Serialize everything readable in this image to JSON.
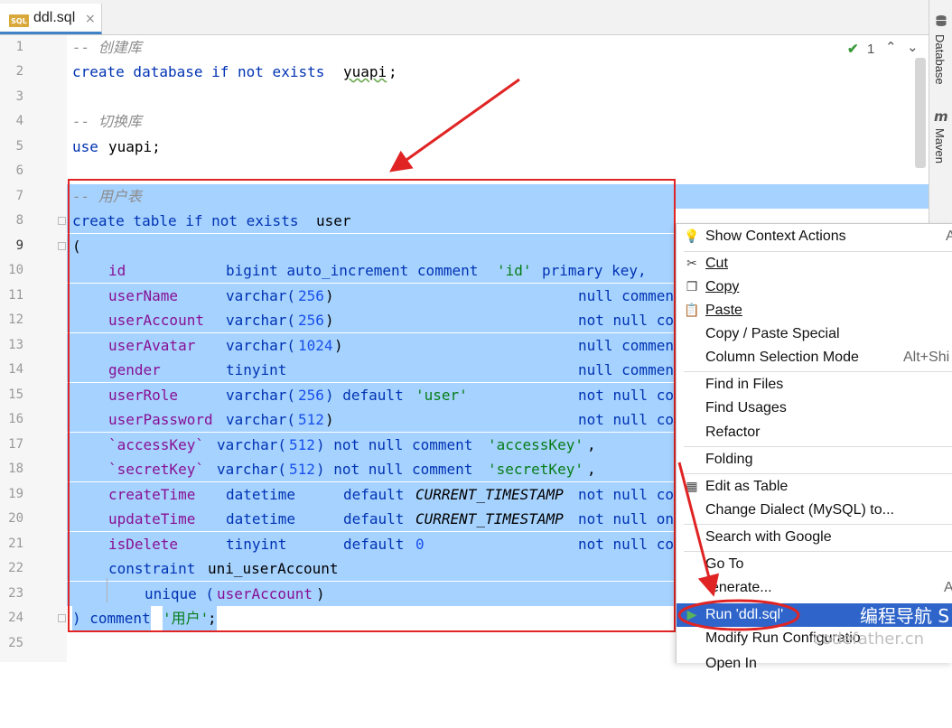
{
  "tab": {
    "icon_text": "SQL",
    "filename": "ddl.sql",
    "close": "×"
  },
  "toolwindows": {
    "database": "Database",
    "maven": "Maven",
    "maven_icon": "m"
  },
  "inspection": {
    "check_icon": "check-icon",
    "count": "1",
    "up": "⌃",
    "down": "⌄"
  },
  "editor": {
    "line_numbers": [
      "1",
      "2",
      "3",
      "4",
      "5",
      "6",
      "7",
      "8",
      "9",
      "10",
      "11",
      "12",
      "13",
      "14",
      "15",
      "16",
      "17",
      "18",
      "19",
      "20",
      "21",
      "22",
      "23",
      "24",
      "25"
    ],
    "current_line": "9",
    "l1": "-- 创建库",
    "l2": {
      "a": "create database if not exists",
      "b": "yuapi",
      "c": ";"
    },
    "l4": "-- 切换库",
    "l5": {
      "a": "use",
      "b": "yuapi;"
    },
    "l7": "-- 用户表",
    "l8": {
      "a": "create table if not exists",
      "b": "user"
    },
    "l9": "(",
    "l10": {
      "c": "id",
      "t": "bigint auto_increment comment",
      "s": "'id'",
      "r": "primary key,"
    },
    "l11": {
      "c": "userName",
      "t": "varchar(",
      "n": "256",
      "p": ")",
      "r": "null commen"
    },
    "l12": {
      "c": "userAccount",
      "t": "varchar(",
      "n": "256",
      "p": ")",
      "r": "not null co"
    },
    "l13": {
      "c": "userAvatar",
      "t": "varchar(",
      "n": "1024",
      "p": ")",
      "r": "null commen"
    },
    "l14": {
      "c": "gender",
      "t": "tinyint",
      "r": "null commen"
    },
    "l15": {
      "c": "userRole",
      "t": "varchar(",
      "n": "256",
      "p": ") default",
      "s": "'user'",
      "r": "not null co"
    },
    "l16": {
      "c": "userPassword",
      "t": "varchar(",
      "n": "512",
      "p": ")",
      "r": "not null co"
    },
    "l17": {
      "c": "`accessKey`",
      "t": "varchar(",
      "n": "512",
      "p": ") not null comment",
      "s": "'accessKey'",
      "e": ","
    },
    "l18": {
      "c": "`secretKey`",
      "t": "varchar(",
      "n": "512",
      "p": ") not null comment",
      "s": "'secretKey'",
      "e": ","
    },
    "l19": {
      "c": "createTime",
      "t": "datetime",
      "d": "default",
      "i": "CURRENT_TIMESTAMP",
      "r": "not null co"
    },
    "l20": {
      "c": "updateTime",
      "t": "datetime",
      "d": "default",
      "i": "CURRENT_TIMESTAMP",
      "r": "not null on"
    },
    "l21": {
      "c": "isDelete",
      "t": "tinyint",
      "d": "default",
      "n": "0",
      "r": "not null co"
    },
    "l22": {
      "a": "constraint",
      "b": "uni_userAccount"
    },
    "l23": {
      "a": "unique (",
      "c": "userAccount",
      "p": ")"
    },
    "l24": {
      "a": ") comment",
      "s": "'用户'",
      "e": ";"
    }
  },
  "menu": {
    "items": [
      {
        "label": "Show Context Actions",
        "shortcut": "A",
        "icon": "lightbulb-icon"
      },
      {
        "label": "Cut",
        "icon": "scissors-icon"
      },
      {
        "label": "Copy",
        "icon": "copy-icon"
      },
      {
        "label": "Paste",
        "icon": "clipboard-icon"
      },
      {
        "label": "Copy / Paste Special"
      },
      {
        "label": "Column Selection Mode",
        "shortcut": "Alt+Shi"
      },
      {
        "label": "Find in Files"
      },
      {
        "label": "Find Usages"
      },
      {
        "label": "Refactor"
      },
      {
        "label": "Folding"
      },
      {
        "label": "Edit as Table",
        "icon": "table-icon"
      },
      {
        "label": "Change Dialect (MySQL) to..."
      },
      {
        "label": "Search with Google"
      },
      {
        "label": "Go To"
      },
      {
        "label": "enerate...",
        "shortcut": "A"
      },
      {
        "label": "Run 'ddl.sql'",
        "icon": "run-icon"
      },
      {
        "label": "Modify Run Configuratio"
      },
      {
        "label": "Open In"
      }
    ]
  },
  "watermark": {
    "line1": "编程导航 S",
    "line2": "codefather.cn"
  },
  "colors": {
    "selection": "#a6d2ff",
    "highlight": "#2f65ca",
    "annotation": "#e02424"
  }
}
